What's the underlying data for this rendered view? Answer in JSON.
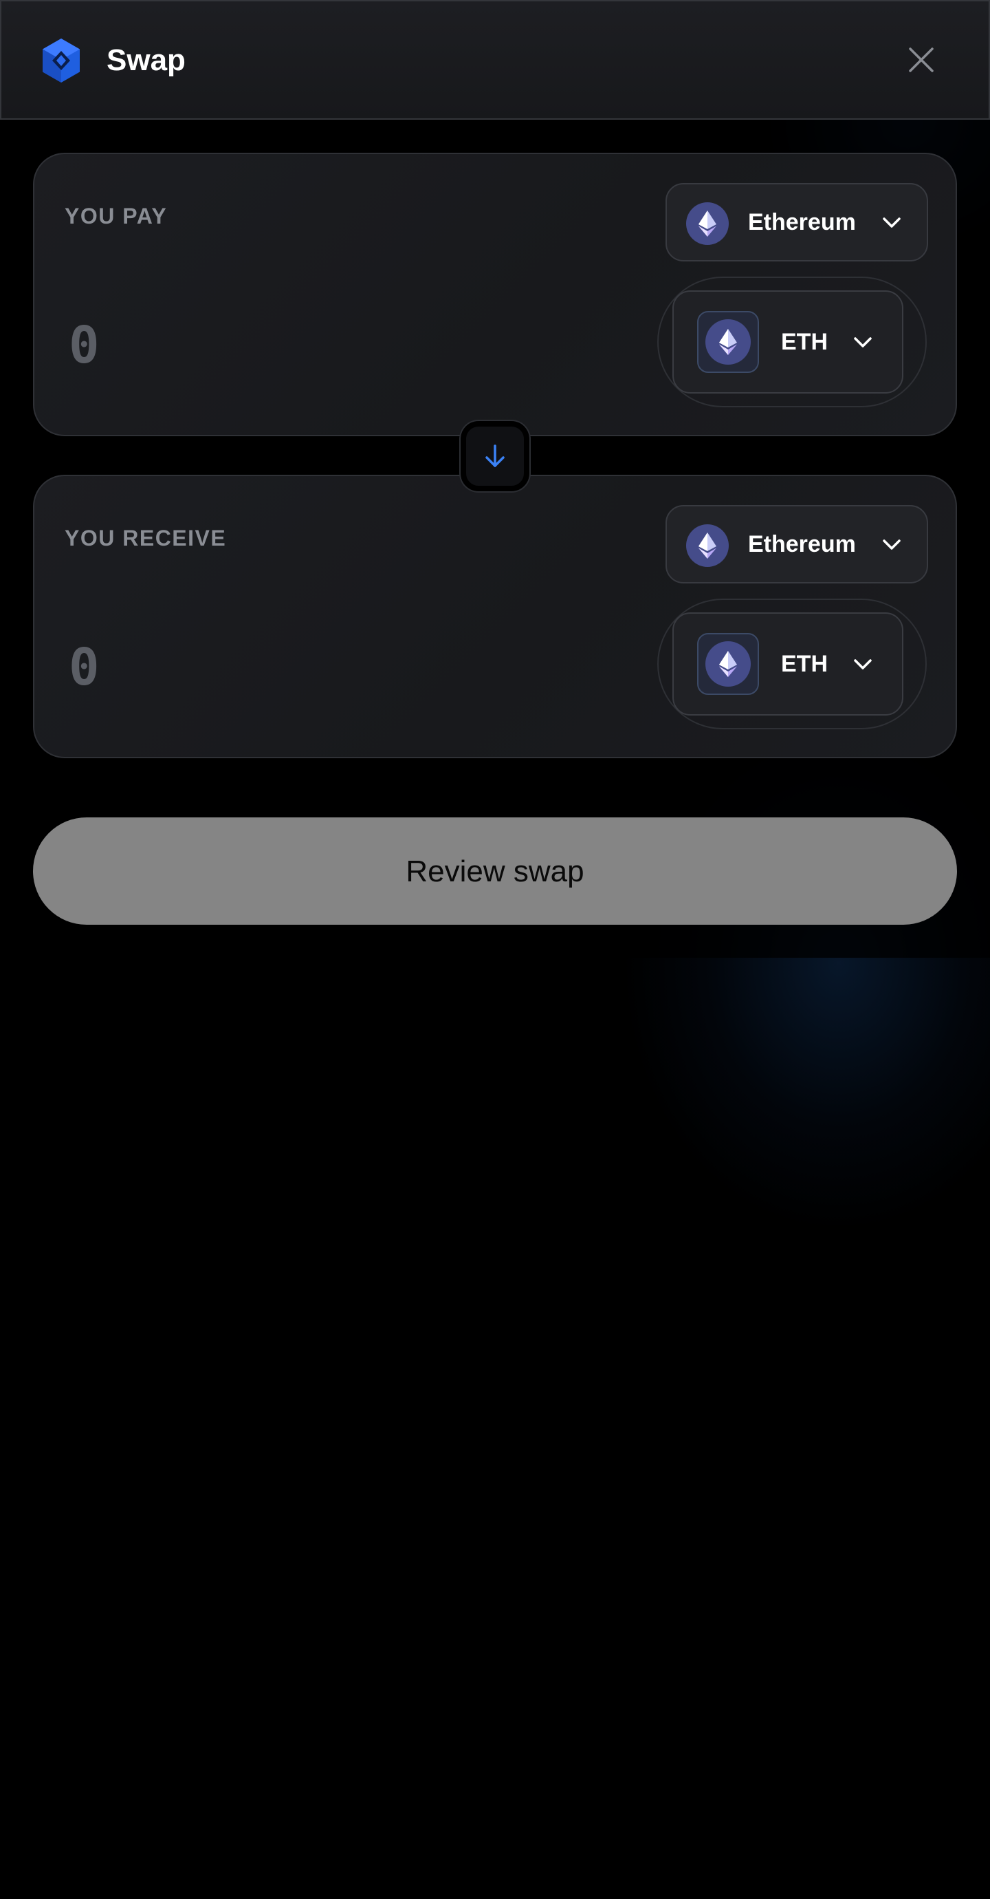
{
  "header": {
    "title": "Swap",
    "logo_icon": "hexagon-logo-icon",
    "close_icon": "close-icon"
  },
  "pay": {
    "label": "YOU PAY",
    "chain": "Ethereum",
    "token": "ETH",
    "amount": "0"
  },
  "receive": {
    "label": "YOU RECEIVE",
    "chain": "Ethereum",
    "token": "ETH",
    "amount": "0"
  },
  "switch_icon": "arrow-down-icon",
  "review_button": "Review swap",
  "colors": {
    "accent": "#3b82f6",
    "logo_blue": "#1f5fe0",
    "eth_badge": "#454c8a",
    "button_disabled": "#858585",
    "background": "#000000"
  }
}
